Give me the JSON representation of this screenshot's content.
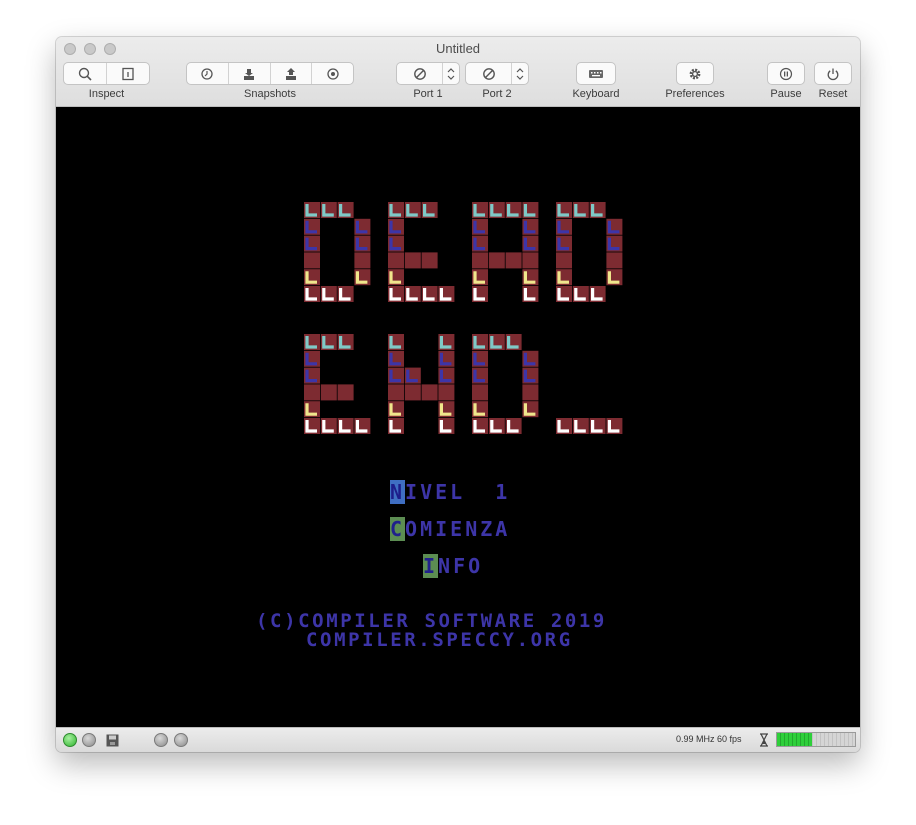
{
  "window": {
    "title": "Untitled"
  },
  "toolbar": {
    "inspect_label": "Inspect",
    "snapshots_label": "Snapshots",
    "port1_label": "Port 1",
    "port2_label": "Port 2",
    "keyboard_label": "Keyboard",
    "preferences_label": "Preferences",
    "pause_label": "Pause",
    "reset_label": "Reset"
  },
  "game": {
    "logo_line1": "DEAD",
    "logo_line2": "END.",
    "menu": [
      {
        "key": "N",
        "rest": "IVEL  1"
      },
      {
        "key": "C",
        "rest": "OMIENZA"
      },
      {
        "key": "I",
        "rest": "NFO"
      }
    ],
    "credits_line1": "(C)COMPILER SOFTWARE 2019",
    "credits_line2": "COMPILER.SPECCY.ORG",
    "colors": {
      "brick": "#7d2b31",
      "cyan": "#7fc9c7",
      "blue": "#3d35a8",
      "yellow": "#f0e68c",
      "white": "#ffffff"
    }
  },
  "statusbar": {
    "speed_text": "0.99 MHz 60 fps",
    "activity_level": 0.45
  }
}
